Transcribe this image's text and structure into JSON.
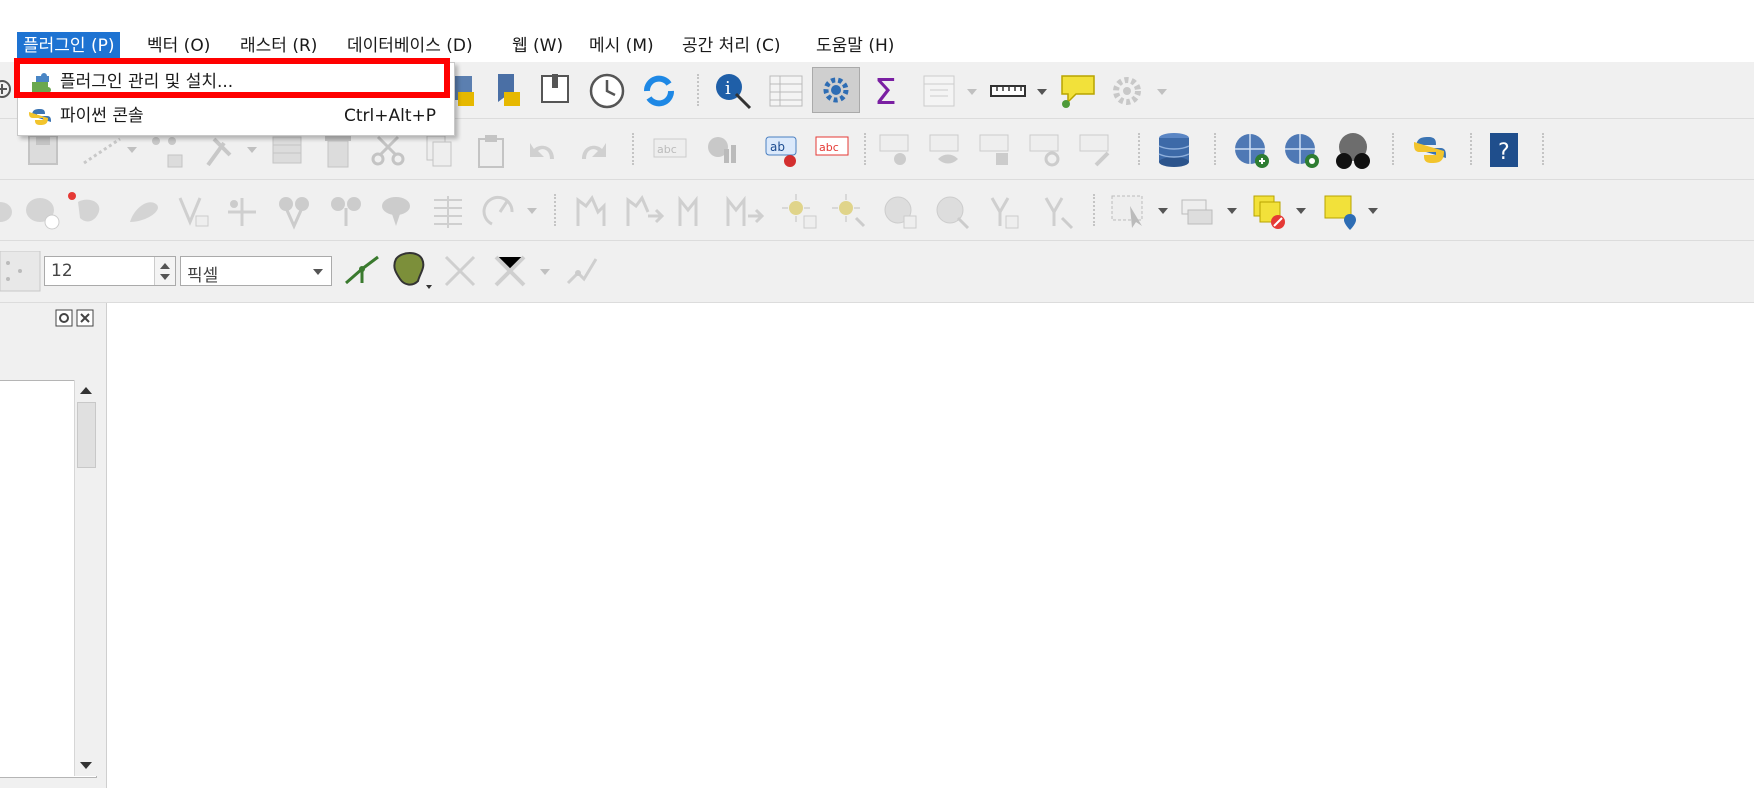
{
  "menubar": {
    "items": [
      {
        "label": "플러그인 (P)",
        "active": true
      },
      {
        "label": "벡터 (O)"
      },
      {
        "label": "래스터 (R)"
      },
      {
        "label": "데이터베이스 (D)"
      },
      {
        "label": "웹 (W)"
      },
      {
        "label": "메시 (M)"
      },
      {
        "label": "공간 처리 (C)"
      },
      {
        "label": "도움말 (H)"
      }
    ]
  },
  "plugin_menu": {
    "items": [
      {
        "label": "플러그인 관리 및 설치...",
        "icon": "puzzle-icon",
        "shortcut": ""
      },
      {
        "label": "파이썬 콘솔",
        "icon": "python-icon",
        "shortcut": "Ctrl+Alt+P"
      }
    ],
    "highlight_color": "#ff0000"
  },
  "snapping_toolbar": {
    "tolerance_value": "12",
    "units_value": "픽셀"
  },
  "colors": {
    "menu_active": "#1e73d2",
    "toolbar_bg": "#f0f0f0",
    "highlight": "#ff0000"
  }
}
